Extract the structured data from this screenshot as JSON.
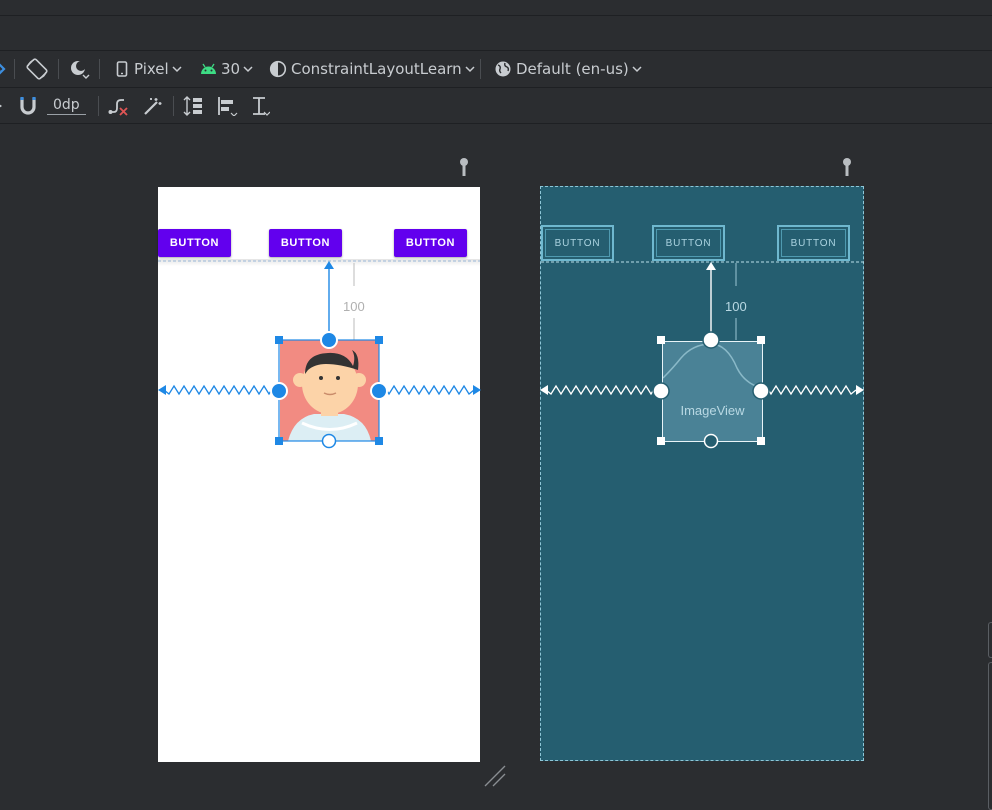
{
  "toolbar": {
    "device": "Pixel",
    "api": "30",
    "theme": "ConstraintLayoutLearn",
    "locale": "Default (en-us)",
    "margin": "0dp"
  },
  "design": {
    "buttons": [
      "BUTTON",
      "BUTTON",
      "BUTTON"
    ],
    "margin_label": "100"
  },
  "blueprint": {
    "buttons": [
      "BUTTON",
      "BUTTON",
      "BUTTON"
    ],
    "margin_label": "100",
    "image_label": "ImageView"
  },
  "colors": {
    "accent_button": "#6200ee",
    "selection": "#1e88e5",
    "blueprint_bg": "#255e70",
    "avatar_bg": "#f28b82"
  }
}
